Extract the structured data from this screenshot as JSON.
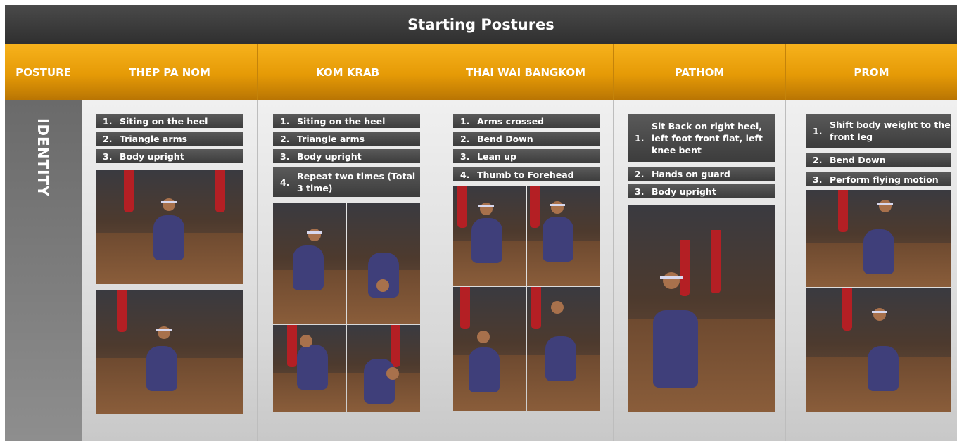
{
  "title": "Starting Postures",
  "header": {
    "posture_label": "POSTURE",
    "columns": [
      "THEP PA NOM",
      "KOM KRAB",
      "THAI WAI BANGKOM",
      "PATHOM",
      "PROM"
    ]
  },
  "row_label": "IDENTITY",
  "postures": [
    {
      "steps": [
        {
          "num": "1.",
          "text": "Siting on the heel"
        },
        {
          "num": "2.",
          "text": "Triangle arms"
        },
        {
          "num": "3.",
          "text": "Body upright"
        }
      ]
    },
    {
      "steps": [
        {
          "num": "1.",
          "text": "Siting on the heel"
        },
        {
          "num": "2.",
          "text": "Triangle arms"
        },
        {
          "num": "3.",
          "text": "Body upright"
        },
        {
          "num": "4.",
          "text": "Repeat two times  (Total 3 time)"
        }
      ]
    },
    {
      "steps": [
        {
          "num": "1.",
          "text": "Arms crossed"
        },
        {
          "num": "2.",
          "text": "Bend Down"
        },
        {
          "num": "3.",
          "text": "Lean up"
        },
        {
          "num": "4.",
          "text": "Thumb to Forehead"
        }
      ]
    },
    {
      "steps": [
        {
          "num": "1.",
          "text": "Sit Back on right  heel, left foot front  flat, left knee bent"
        },
        {
          "num": "2.",
          "text": "Hands on guard"
        },
        {
          "num": "3.",
          "text": "Body upright"
        }
      ]
    },
    {
      "steps": [
        {
          "num": "1.",
          "text": "Shift body weight to the front leg"
        },
        {
          "num": "2.",
          "text": "Bend Down"
        },
        {
          "num": "3.",
          "text": "Perform flying motion"
        }
      ]
    }
  ],
  "colors": {
    "title_bg": "#3a3a3a",
    "header_orange": "#f0a612",
    "step_bg": "#4a4a4a",
    "identity_bg": "#7a7a7a"
  }
}
